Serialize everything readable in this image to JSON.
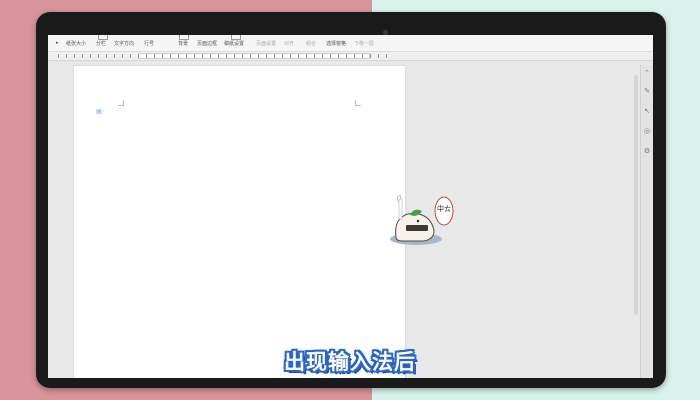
{
  "toolbar": {
    "items": [
      "纸张大小",
      "分栏",
      "文字方向",
      "行号",
      "背景",
      "页面边框",
      "稿纸设置",
      "页面设置",
      "对齐",
      "组合",
      "选择窗格",
      "下移一层"
    ]
  },
  "caption": "出现输入法后",
  "sticker": {
    "bubble_text": "中ㄊ"
  },
  "colors": {
    "bg_left": "#d8959b",
    "bg_right": "#d9f3ec",
    "bezel": "#1a1a1a",
    "caption_outline": "#2a66c9"
  },
  "icons": {
    "sidebar": [
      "chevron-up-icon",
      "pen-icon",
      "cursor-icon",
      "compass-icon",
      "settings-icon"
    ]
  }
}
